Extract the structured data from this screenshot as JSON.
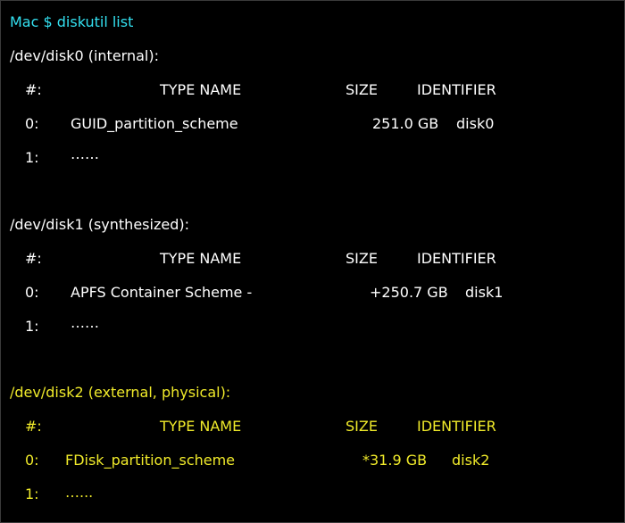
{
  "colors": {
    "background": "#000000",
    "prompt": "#33e0f0",
    "normal_text": "#ffffff",
    "highlight_text": "#f0ea2a"
  },
  "prompt": "Mac $ diskutil list",
  "disks": [
    {
      "header": "/dev/disk0 (internal):",
      "columns": {
        "index": "#:",
        "type_name": "TYPE NAME",
        "size": "SIZE",
        "identifier": "IDENTIFIER"
      },
      "rows": [
        {
          "index": "0:",
          "name": "GUID_partition_scheme",
          "size": "251.0 GB",
          "identifier": "disk0"
        },
        {
          "index": "1:",
          "name": "……"
        }
      ]
    },
    {
      "header": "/dev/disk1 (synthesized):",
      "columns": {
        "index": "#:",
        "type_name": "TYPE NAME",
        "size": "SIZE",
        "identifier": "IDENTIFIER"
      },
      "rows": [
        {
          "index": "0:",
          "name": "APFS Container Scheme -",
          "size": "+250.7 GB",
          "identifier": "disk1"
        },
        {
          "index": "1:",
          "name": "……"
        }
      ]
    },
    {
      "header": "/dev/disk2 (external, physical):",
      "columns": {
        "index": "#:",
        "type_name": "TYPE NAME",
        "size": "SIZE",
        "identifier": "IDENTIFIER"
      },
      "rows": [
        {
          "index": "0:",
          "name": "FDisk_partition_scheme",
          "size": "*31.9 GB",
          "identifier": "disk2"
        },
        {
          "index": "1:",
          "name": "…..."
        }
      ]
    }
  ]
}
